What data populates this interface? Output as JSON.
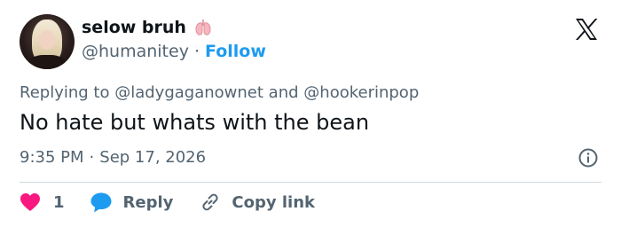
{
  "author": {
    "display_name": "selow bruh",
    "handle": "@humanitey",
    "separator": "·",
    "follow_label": "Follow",
    "badge_icon": "lungs-icon"
  },
  "reply_context": {
    "prefix": "Replying to",
    "mention1": "@ladygaganownet",
    "conjunction": "and",
    "mention2": "@hookerinpop"
  },
  "tweet": {
    "text": "No hate but whats with the bean",
    "time": "9:35 PM",
    "separator": "·",
    "date": "Sep 17, 2026"
  },
  "actions": {
    "like_count": "1",
    "reply_label": "Reply",
    "copy_label": "Copy link"
  },
  "colors": {
    "accent": "#1d9bf0",
    "like": "#f91880",
    "muted": "#536471",
    "text": "#0f1419"
  }
}
